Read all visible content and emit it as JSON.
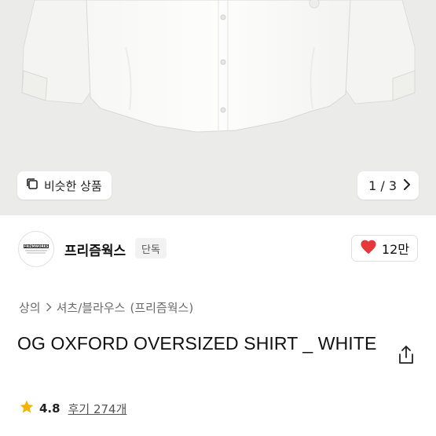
{
  "gallery": {
    "similar_button_label": "비슷한 상품",
    "counter": "1 / 3"
  },
  "brand": {
    "logo_text": "FRIZMWORKS",
    "name": "프리즘웍스",
    "badge": "단독",
    "like_count": "12만"
  },
  "breadcrumb": {
    "items": [
      "상의",
      "셔츠/블라우스",
      "(프리즘웍스)"
    ]
  },
  "product": {
    "title": "OG OXFORD OVERSIZED SHIRT _ WHITE"
  },
  "rating": {
    "score": "4.8",
    "reviews": "후기 274개"
  },
  "colors": {
    "like_heart": "#e5383b",
    "star": "#f5b400"
  },
  "icons": [
    "copy-icon",
    "chevron-right-icon",
    "heart-icon",
    "share-icon",
    "star-icon"
  ]
}
